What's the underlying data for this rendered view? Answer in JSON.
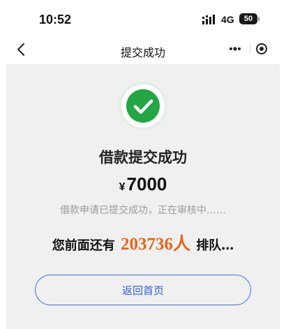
{
  "status_bar": {
    "time": "10:52",
    "network": "4G",
    "battery": "50"
  },
  "nav": {
    "title": "提交成功"
  },
  "result": {
    "title": "借款提交成功",
    "currency_symbol": "¥",
    "amount": "7000",
    "status_message": "借款申请已提交成功，正在审核中……",
    "queue_prefix": "您前面还有",
    "queue_number": "203736人",
    "queue_suffix": "排队…"
  },
  "actions": {
    "home_button": "返回首页"
  },
  "icons": {
    "back": "chevron-left-icon",
    "more": "more-dots-icon",
    "close": "target-close-icon",
    "success": "check-circle-icon",
    "signal": "signal-icon"
  },
  "colors": {
    "success_green": "#22a744",
    "highlight_orange": "#e8651a",
    "button_blue": "#3d6de0",
    "background_gray": "#f0f0f0"
  }
}
